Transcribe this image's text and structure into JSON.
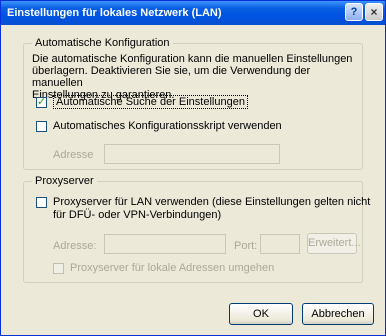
{
  "window": {
    "title": "Einstellungen für lokales Netzwerk (LAN)",
    "help_button": "?",
    "close_button": "×"
  },
  "auto_config": {
    "legend": "Automatische Konfiguration",
    "description_lines": [
      "Die automatische Konfiguration kann die manuellen Einstellungen",
      "überlagern. Deaktivieren Sie sie, um die Verwendung der manuellen",
      "Einstellungen zu garantieren."
    ],
    "auto_detect": {
      "label": "Automatische Suche der Einstellungen",
      "checked": true
    },
    "use_script": {
      "label": "Automatisches Konfigurationsskript verwenden",
      "checked": false
    },
    "address_label": "Adresse",
    "address_value": ""
  },
  "proxy": {
    "legend": "Proxyserver",
    "use_proxy": {
      "label_line1": "Proxyserver für LAN verwenden (diese Einstellungen gelten nicht",
      "label_line2": "für DFÜ- oder VPN-Verbindungen)",
      "checked": false
    },
    "address_label": "Adresse:",
    "address_value": "",
    "port_label": "Port:",
    "port_value": "",
    "advanced_button": "Erweitert...",
    "bypass": {
      "label": "Proxyserver für lokale Adressen umgehen",
      "checked": false
    }
  },
  "buttons": {
    "ok": "OK",
    "cancel": "Abbrechen"
  }
}
